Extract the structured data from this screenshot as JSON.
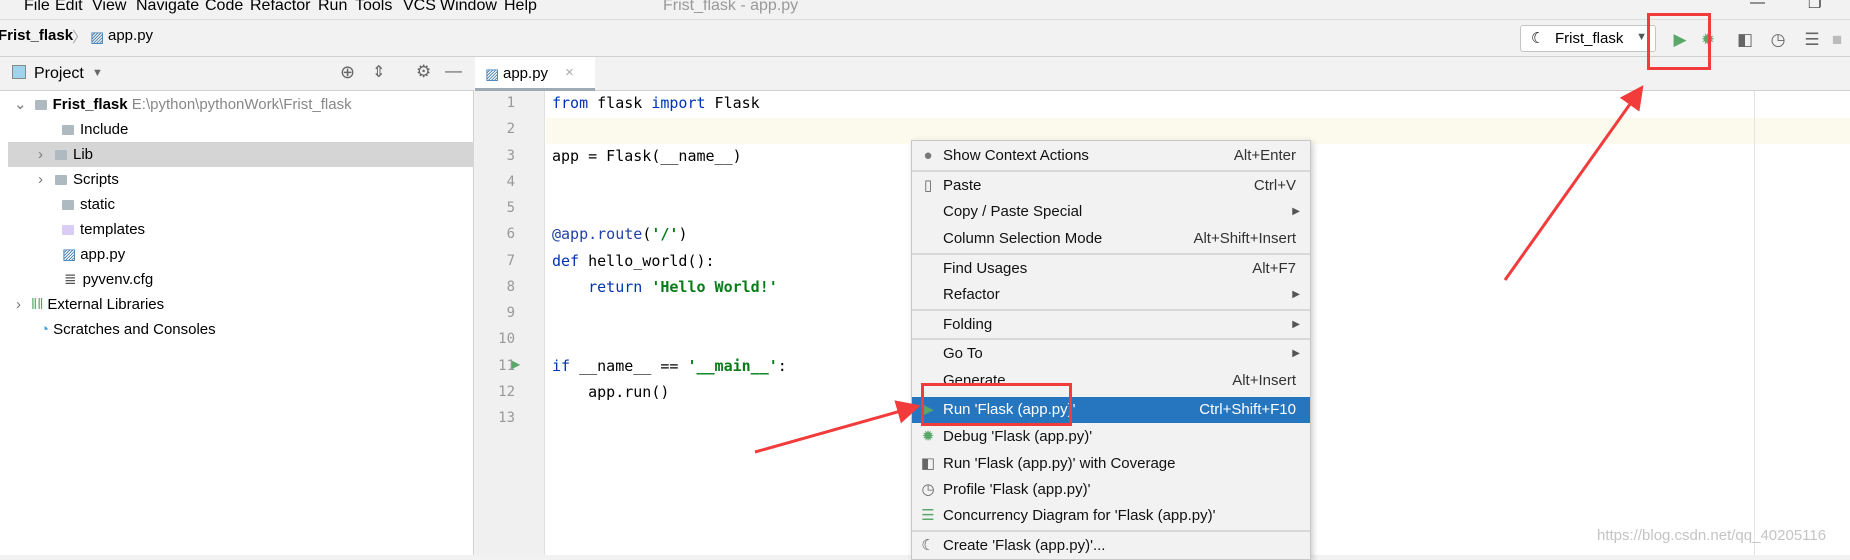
{
  "menubar": {
    "items": [
      "File",
      "Edit",
      "View",
      "Navigate",
      "Code",
      "Refactor",
      "Run",
      "Tools",
      "VCS",
      "Window",
      "Help"
    ],
    "title": "Frist_flask - app.py"
  },
  "breadcrumb": {
    "project": "Frist_flask",
    "file": "app.py"
  },
  "toolbar": {
    "run_config": "Frist_flask",
    "icons": [
      "run-icon",
      "debug-icon",
      "coverage-icon",
      "profile-icon",
      "concurrency-icon",
      "stop-icon"
    ]
  },
  "project_panel": {
    "title": "Project",
    "tree": [
      {
        "label": "Frist_flask",
        "path": "E:\\python\\pythonWork\\Frist_flask",
        "expanded": true
      },
      {
        "label": "Include"
      },
      {
        "label": "Lib",
        "selected": true
      },
      {
        "label": "Scripts"
      },
      {
        "label": "static"
      },
      {
        "label": "templates"
      },
      {
        "label": "app.py"
      },
      {
        "label": "pyvenv.cfg"
      },
      {
        "label": "External Libraries"
      },
      {
        "label": "Scratches and Consoles"
      }
    ]
  },
  "editor": {
    "tab": "app.py",
    "lines": [
      "from flask import Flask",
      "",
      "app = Flask(__name__)",
      "",
      "",
      "@app.route('/')",
      "def hello_world():",
      "    return 'Hello World!'",
      "",
      "",
      "if __name__ == '__main__':",
      "    app.run()",
      ""
    ],
    "line_numbers": [
      "1",
      "2",
      "3",
      "4",
      "5",
      "6",
      "7",
      "8",
      "9",
      "10",
      "11",
      "12",
      "13"
    ]
  },
  "context_menu": [
    {
      "label": "Show Context Actions",
      "shortcut": "Alt+Enter"
    },
    {
      "label": "Paste",
      "shortcut": "Ctrl+V"
    },
    {
      "label": "Copy / Paste Special"
    },
    {
      "label": "Column Selection Mode",
      "shortcut": "Alt+Shift+Insert"
    },
    {
      "label": "Find Usages",
      "shortcut": "Alt+F7"
    },
    {
      "label": "Refactor"
    },
    {
      "label": "Folding"
    },
    {
      "label": "Go To"
    },
    {
      "label": "Generate",
      "shortcut": "Alt+Insert"
    },
    {
      "label": "Run 'Flask (app.py)'",
      "shortcut": "Ctrl+Shift+F10"
    },
    {
      "label": "Debug 'Flask (app.py)'"
    },
    {
      "label": "Run 'Flask (app.py)' with Coverage"
    },
    {
      "label": "Profile 'Flask (app.py)'"
    },
    {
      "label": "Concurrency Diagram for 'Flask (app.py)'"
    },
    {
      "label": "Create 'Flask (app.py)'..."
    }
  ],
  "watermark": "https://blog.csdn.net/qq_40205116",
  "colors": {
    "highlight": "#2675bf",
    "annotation": "#f23b3b",
    "run_green": "#59a869"
  }
}
